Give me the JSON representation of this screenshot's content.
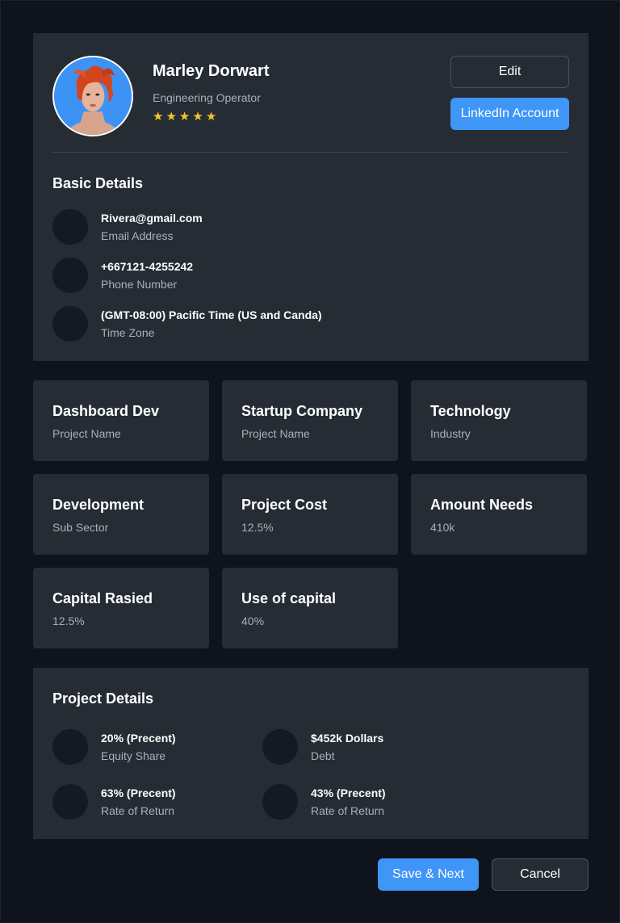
{
  "profile": {
    "name": "Marley Dorwart",
    "role": "Engineering Operator",
    "rating": 5,
    "edit_label": "Edit",
    "linkedin_label": "LinkedIn Account"
  },
  "basic_details": {
    "title": "Basic Details",
    "items": [
      {
        "value": "Rivera@gmail.com",
        "label": "Email Address"
      },
      {
        "value": "+667121-4255242",
        "label": "Phone Number"
      },
      {
        "value": "(GMT-08:00) Pacific Time (US and Canda)",
        "label": "Time Zone"
      }
    ]
  },
  "cards": [
    {
      "title": "Dashboard Dev",
      "sub": "Project Name"
    },
    {
      "title": "Startup Company",
      "sub": "Project Name"
    },
    {
      "title": "Technology",
      "sub": "Industry"
    },
    {
      "title": "Development",
      "sub": "Sub Sector"
    },
    {
      "title": "Project Cost",
      "sub": "12.5%"
    },
    {
      "title": "Amount Needs",
      "sub": "410k"
    },
    {
      "title": "Capital Rasied",
      "sub": "12.5%"
    },
    {
      "title": "Use of capital",
      "sub": "40%"
    }
  ],
  "project_details": {
    "title": "Project Details",
    "items": [
      {
        "value": "20% (Precent)",
        "label": "Equity Share"
      },
      {
        "value": "$452k Dollars",
        "label": "Debt"
      },
      {
        "value": "63% (Precent)",
        "label": "Rate of Return"
      },
      {
        "value": "43% (Precent)",
        "label": "Rate of Return"
      }
    ]
  },
  "footer": {
    "save_label": "Save & Next",
    "cancel_label": "Cancel"
  },
  "colors": {
    "background": "#0f141c",
    "panel": "#252c33",
    "accent": "#4096f7",
    "star": "#f5c42a",
    "muted_text": "#a9b0b9"
  }
}
